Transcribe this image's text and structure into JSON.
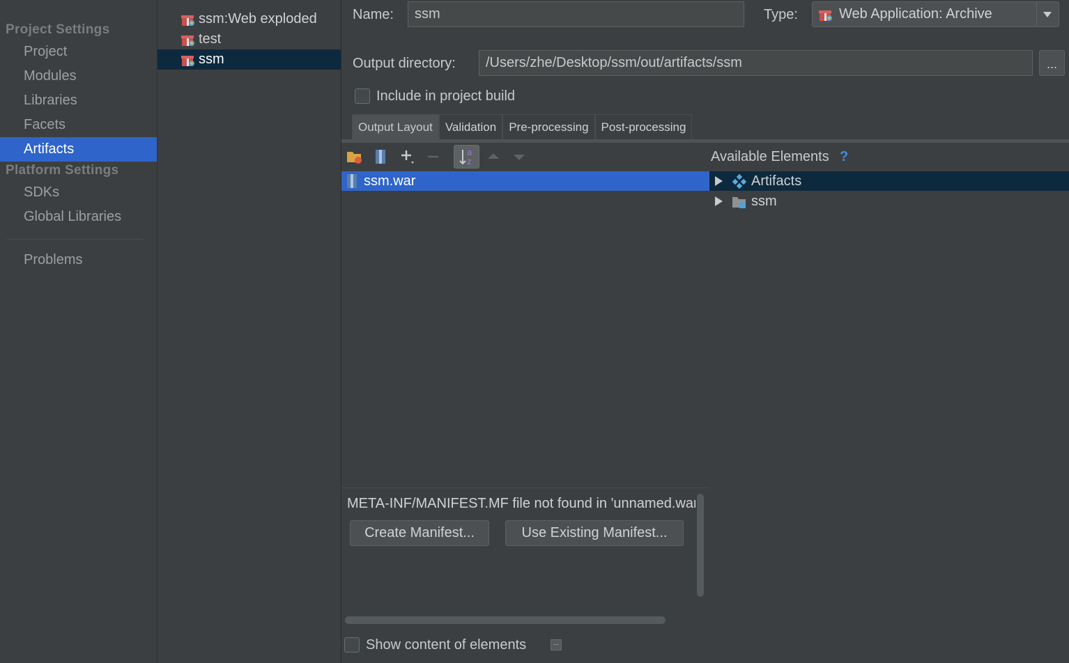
{
  "nav": {
    "project_settings_header": "Project Settings",
    "project_items": [
      "Project",
      "Modules",
      "Libraries",
      "Facets",
      "Artifacts"
    ],
    "platform_settings_header": "Platform Settings",
    "platform_items": [
      "SDKs",
      "Global Libraries"
    ],
    "problems": "Problems",
    "selected": "Artifacts"
  },
  "artifacts": {
    "items": [
      "ssm:Web exploded",
      "test",
      "ssm"
    ],
    "selected": "ssm"
  },
  "form": {
    "name_label": "Name:",
    "name_value": "ssm",
    "type_label": "Type:",
    "type_value": "Web Application: Archive",
    "output_label": "Output directory:",
    "output_value": "/Users/zhe/Desktop/ssm/out/artifacts/ssm",
    "browse_label": "...",
    "include_label": "Include in project build"
  },
  "tabs": [
    "Output Layout",
    "Validation",
    "Pre-processing",
    "Post-processing"
  ],
  "layout": {
    "root_item": "ssm.war"
  },
  "available": {
    "title": "Available Elements",
    "help": "?",
    "items": [
      "Artifacts",
      "ssm"
    ]
  },
  "manifest": {
    "message": "META-INF/MANIFEST.MF file not found in 'unnamed.war'",
    "create_button": "Create Manifest...",
    "existing_button": "Use Existing Manifest..."
  },
  "footer": {
    "show_content_label": "Show content of elements",
    "more_label": "..."
  },
  "colors": {
    "background": "#3c3f41",
    "selection_blue": "#2f65ca",
    "selection_dark": "#0d293e",
    "help_blue": "#3d8fdc"
  }
}
